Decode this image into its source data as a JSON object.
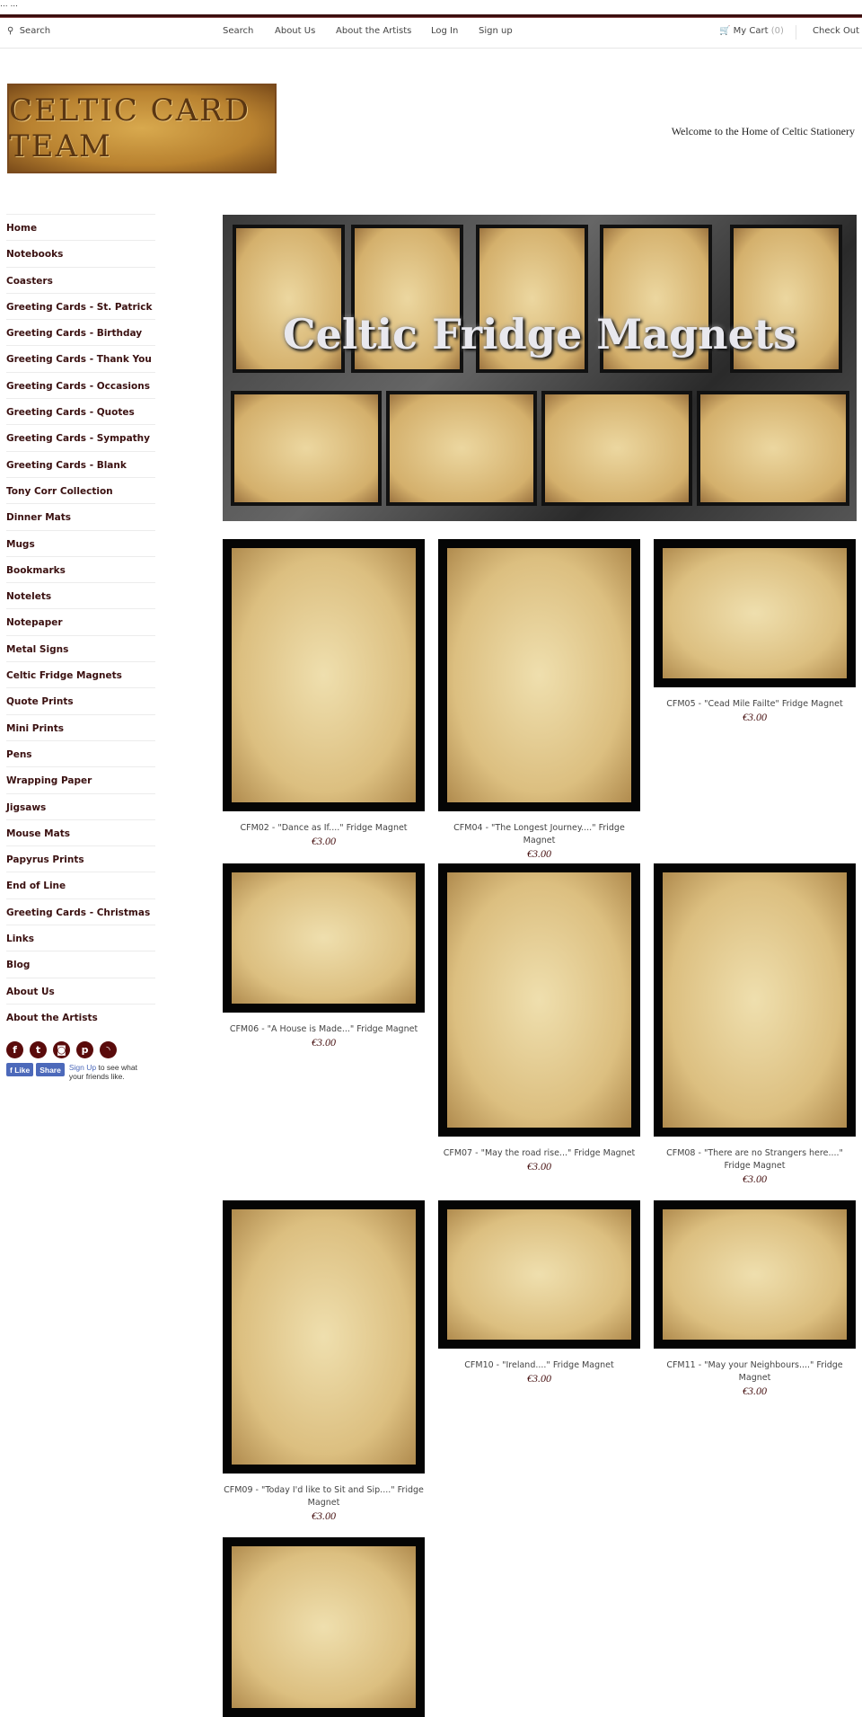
{
  "top_dots": "... ...",
  "nav": {
    "search_label": "Search",
    "links": [
      "Search",
      "About Us",
      "About the Artists",
      "Log In",
      "Sign up"
    ],
    "cart_label": "My Cart",
    "cart_count": "(0)",
    "checkout": "Check Out"
  },
  "header": {
    "logo_text": "CELTIC CARD TEAM",
    "welcome": "Welcome to the Home of Celtic Stationery"
  },
  "sidebar": {
    "items": [
      "Home",
      "Notebooks",
      "Coasters",
      "Greeting Cards - St. Patrick",
      "Greeting Cards - Birthday",
      "Greeting Cards - Thank You",
      "Greeting Cards - Occasions",
      "Greeting Cards - Quotes",
      "Greeting Cards - Sympathy",
      "Greeting Cards - Blank",
      "Tony Corr Collection",
      "Dinner Mats",
      "Mugs",
      "Bookmarks",
      "Notelets",
      "Notepaper",
      "Metal Signs",
      "Celtic Fridge Magnets",
      "Quote Prints",
      "Mini Prints",
      "Pens",
      "Wrapping Paper",
      "Jigsaws",
      "Mouse Mats",
      "Papyrus Prints",
      "End of Line",
      "Greeting Cards - Christmas",
      "Links",
      "Blog",
      "About Us",
      "About the Artists"
    ]
  },
  "social": {
    "icons": [
      "facebook-icon",
      "twitter-icon",
      "instagram-icon",
      "pinterest-icon",
      "rss-icon"
    ],
    "like": "Like",
    "share": "Share",
    "signup_link": "Sign Up",
    "signup_text": " to see what your friends like."
  },
  "banner": {
    "title": "Celtic Fridge Magnets"
  },
  "products": [
    {
      "name": "CFM02 - \"Dance as If....\" Fridge Magnet",
      "price": "€3.00"
    },
    {
      "name": "CFM04 - \"The Longest Journey....\" Fridge Magnet",
      "price": "€3.00"
    },
    {
      "name": "CFM05 - \"Cead Mile Failte\" Fridge Magnet",
      "price": "€3.00"
    },
    {
      "name": "CFM06 - \"A House is Made...\" Fridge Magnet",
      "price": "€3.00"
    },
    {
      "name": "CFM07 - \"May the road rise...\" Fridge Magnet",
      "price": "€3.00"
    },
    {
      "name": "CFM08 - \"There are no Strangers here....\" Fridge Magnet",
      "price": "€3.00"
    },
    {
      "name": "CFM09 - \"Today I'd like to Sit and Sip....\" Fridge Magnet",
      "price": "€3.00"
    },
    {
      "name": "CFM10 - \"Ireland....\" Fridge Magnet",
      "price": "€3.00"
    },
    {
      "name": "CFM11 - \"May your Neighbours....\" Fridge Magnet",
      "price": "€3.00"
    },
    {
      "name": "",
      "price": ""
    }
  ],
  "colors": {
    "accent": "#3b0d0d",
    "price": "#4a1515",
    "social": "#5a0b0b",
    "facebook": "#4c69ba"
  }
}
